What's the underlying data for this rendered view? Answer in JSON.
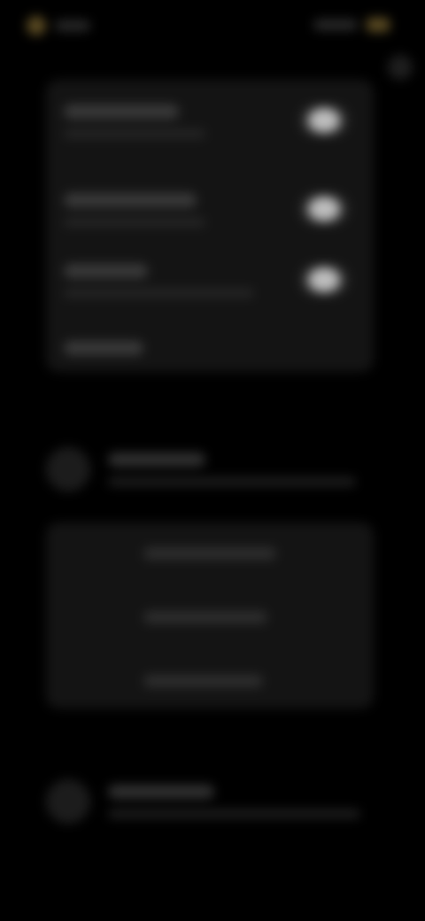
{
  "status_bar": {
    "left_indicator": "status-dot",
    "right_indicator": "battery-icon"
  },
  "colors": {
    "background": "#000000",
    "panel": "#141414",
    "accent": "#5a4a22",
    "toggle_knob": "#bdbdbd"
  },
  "settings_panel": {
    "rows": [
      {
        "toggle_on": true
      },
      {
        "toggle_on": true
      },
      {
        "toggle_on": true
      },
      {
        "toggle_on": false
      }
    ]
  },
  "section_one": {
    "icon": "circle-icon",
    "items": [
      {},
      {},
      {}
    ]
  },
  "section_two": {
    "icon": "circle-icon"
  }
}
